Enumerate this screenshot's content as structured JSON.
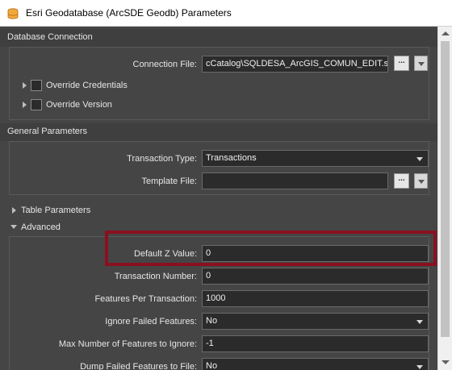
{
  "window": {
    "title": "Esri Geodatabase (ArcSDE Geodb) Parameters",
    "icon": "database-icon"
  },
  "database_connection": {
    "header": "Database Connection",
    "connection_file_label": "Connection File:",
    "connection_file_value": "cCatalog\\SQLDESA_ArcGIS_COMUN_EDIT.sde",
    "browse_label": "...",
    "override_credentials": "Override Credentials",
    "override_version": "Override Version"
  },
  "general_parameters": {
    "header": "General Parameters",
    "transaction_type_label": "Transaction Type:",
    "transaction_type_value": "Transactions",
    "template_file_label": "Template File:",
    "template_file_value": "",
    "browse_label": "..."
  },
  "table_parameters": {
    "label": "Table Parameters"
  },
  "advanced": {
    "label": "Advanced",
    "default_z_label": "Default Z Value:",
    "default_z_value": "0",
    "transaction_number_label": "Transaction Number:",
    "transaction_number_value": "0",
    "features_per_transaction_label": "Features Per Transaction:",
    "features_per_transaction_value": "1000",
    "ignore_failed_label": "Ignore Failed Features:",
    "ignore_failed_value": "No",
    "max_ignore_label": "Max Number of Features to Ignore:",
    "max_ignore_value": "-1",
    "dump_failed_label": "Dump Failed Features to File:",
    "dump_failed_value": "No"
  },
  "colors": {
    "highlight": "#8a1020",
    "panel": "#454545",
    "field": "#2b2b2b"
  }
}
